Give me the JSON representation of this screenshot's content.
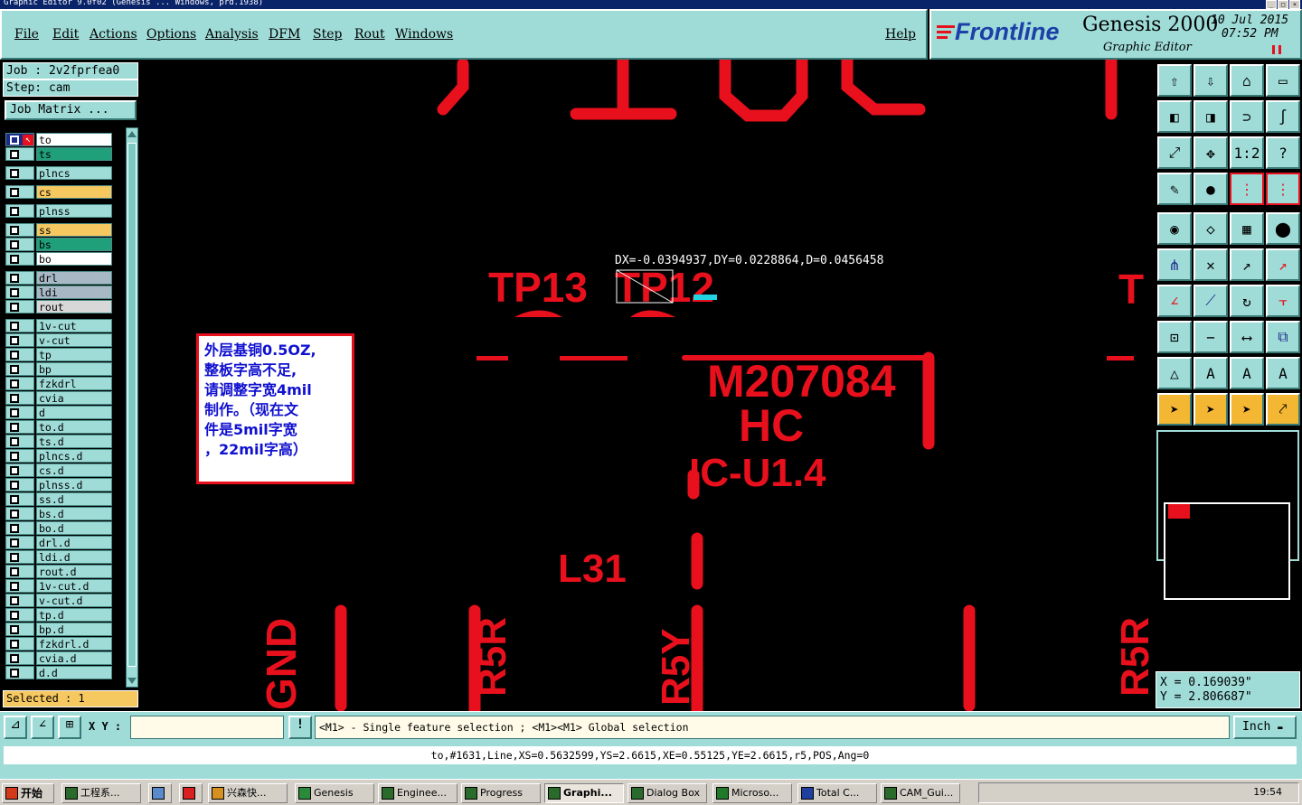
{
  "window": {
    "title": "Graphic Editor 9.0f02 (Genesis ... Windows, prd.1938)"
  },
  "menu": {
    "file": "File",
    "edit": "Edit",
    "actions": "Actions",
    "options": "Options",
    "analysis": "Analysis",
    "dfm": "DFM",
    "step": "Step",
    "rout": "Rout",
    "windows": "Windows",
    "help": "Help"
  },
  "brand": {
    "logo": "Frontline",
    "product": "Genesis 2000",
    "subtitle": "Graphic Editor",
    "date": "10 Jul 2015",
    "time": "07:52 PM"
  },
  "job": {
    "job_label": "Job : 2v2fprfea0",
    "step_label": "Step: cam",
    "matrix_button": "Job Matrix ..."
  },
  "layers": [
    {
      "name": "to",
      "color": "#ffffff"
    },
    {
      "name": "ts",
      "color": "#1fa07a"
    },
    {
      "name": "plncs",
      "color": "#9fdcd8"
    },
    {
      "name": "cs",
      "color": "#f6c860"
    },
    {
      "name": "plnss",
      "color": "#9fdcd8"
    },
    {
      "name": "ss",
      "color": "#f6c860"
    },
    {
      "name": "bs",
      "color": "#1fa07a"
    },
    {
      "name": "bo",
      "color": "#ffffff"
    },
    {
      "name": "drl",
      "color": "#a8b8c4"
    },
    {
      "name": "ldi",
      "color": "#a8b8c4"
    },
    {
      "name": "rout",
      "color": "#d8d8d8"
    },
    {
      "name": "1v-cut",
      "color": "#9fdcd8"
    },
    {
      "name": "v-cut",
      "color": "#9fdcd8"
    },
    {
      "name": "tp",
      "color": "#9fdcd8"
    },
    {
      "name": "bp",
      "color": "#9fdcd8"
    },
    {
      "name": "fzkdrl",
      "color": "#9fdcd8"
    },
    {
      "name": "cvia",
      "color": "#9fdcd8"
    },
    {
      "name": "d",
      "color": "#9fdcd8"
    },
    {
      "name": "to.d",
      "color": "#9fdcd8"
    },
    {
      "name": "ts.d",
      "color": "#9fdcd8"
    },
    {
      "name": "plncs.d",
      "color": "#9fdcd8"
    },
    {
      "name": "cs.d",
      "color": "#9fdcd8"
    },
    {
      "name": "plnss.d",
      "color": "#9fdcd8"
    },
    {
      "name": "ss.d",
      "color": "#9fdcd8"
    },
    {
      "name": "bs.d",
      "color": "#9fdcd8"
    },
    {
      "name": "bo.d",
      "color": "#9fdcd8"
    },
    {
      "name": "drl.d",
      "color": "#9fdcd8"
    },
    {
      "name": "ldi.d",
      "color": "#9fdcd8"
    },
    {
      "name": "rout.d",
      "color": "#9fdcd8"
    },
    {
      "name": "1v-cut.d",
      "color": "#9fdcd8"
    },
    {
      "name": "v-cut.d",
      "color": "#9fdcd8"
    },
    {
      "name": "tp.d",
      "color": "#9fdcd8"
    },
    {
      "name": "bp.d",
      "color": "#9fdcd8"
    },
    {
      "name": "fzkdrl.d",
      "color": "#9fdcd8"
    },
    {
      "name": "cvia.d",
      "color": "#9fdcd8"
    },
    {
      "name": "d.d",
      "color": "#9fdcd8"
    }
  ],
  "selected": "Selected : 1",
  "measure": "DX=-0.0394937,DY=0.0228864,D=0.0456458",
  "note": [
    "外层基铜0.5OZ,",
    "整板字高不足,",
    "请调整字宽4mil",
    "制作。（现在文",
    "件是5mil字宽",
    "，22mil字高）"
  ],
  "silk": {
    "tp13": "TP13",
    "tp12": "TP12",
    "m": "M207084",
    "hc": "HC",
    "ic": "IC-U1.4",
    "l31": "L31",
    "gnd": "GND",
    "r5r": "R5R",
    "r5y": "R5Y",
    "r5r2": "R5R"
  },
  "coords": {
    "x": "X = 0.169039\"",
    "y": "Y = 2.806687\""
  },
  "cmd": {
    "xy_label": "X Y :",
    "xy_value": "",
    "prompt": "<M1> - Single feature selection ; <M1><M1> Global selection",
    "units": "Inch"
  },
  "status": "to,#1631,Line,XS=0.5632599,YS=2.6615,XE=0.55125,YE=2.6615,r5,POS,Ang=0",
  "taskbar": {
    "start": "开始",
    "items": [
      "工程系...",
      "兴森快...",
      "Genesis",
      "Enginee...",
      "Progress",
      "Graphi...",
      "Dialog Box",
      "Microso...",
      "Total C...",
      "CAM_Gui..."
    ],
    "clock": "19:54"
  },
  "colors": {
    "panel": "#9fdcd8",
    "silk": "#e8101c",
    "accent": "#f6c860"
  }
}
